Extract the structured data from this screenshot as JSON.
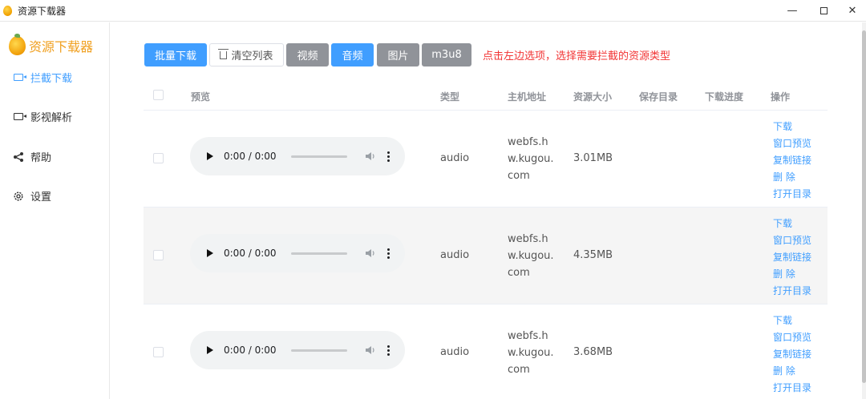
{
  "window": {
    "title": "资源下载器",
    "controls": {
      "minimize": "—",
      "close": "✕"
    }
  },
  "sidebar": {
    "app_name": "资源下载器",
    "items": [
      {
        "label": "拦截下载",
        "icon": "video-camera-icon",
        "active": true
      },
      {
        "label": "影视解析",
        "icon": "video-camera-icon",
        "active": false
      },
      {
        "label": "帮助",
        "icon": "share-icon",
        "active": false
      },
      {
        "label": "设置",
        "icon": "gear-icon",
        "active": false
      }
    ]
  },
  "toolbar": {
    "batch_download": "批量下载",
    "clear_list": "清空列表",
    "filters": {
      "video": "视频",
      "audio": "音频",
      "image": "图片",
      "m3u8": "m3u8"
    },
    "active_filter": "audio",
    "hint": "点击左边选项，选择需要拦截的资源类型"
  },
  "table": {
    "headers": {
      "preview": "预览",
      "type": "类型",
      "host": "主机地址",
      "size": "资源大小",
      "save_dir": "保存目录",
      "progress": "下载进度",
      "actions": "操作"
    },
    "rows": [
      {
        "time": "0:00 / 0:00",
        "type": "audio",
        "host": "webfs.hw.kugou.com",
        "size": "3.01MB",
        "save_dir": "",
        "progress": ""
      },
      {
        "time": "0:00 / 0:00",
        "type": "audio",
        "host": "webfs.hw.kugou.com",
        "size": "4.35MB",
        "save_dir": "",
        "progress": ""
      },
      {
        "time": "0:00 / 0:00",
        "type": "audio",
        "host": "webfs.hw.kugou.com",
        "size": "3.68MB",
        "save_dir": "",
        "progress": ""
      }
    ],
    "row_actions": {
      "download": "下载",
      "preview_window": "窗口预览",
      "copy_link": "复制链接",
      "delete": "删 除",
      "open_dir": "打开目录"
    }
  },
  "colors": {
    "primary": "#409eff",
    "gray_button": "#909399",
    "hint": "#f23535",
    "brand": "#f0a020"
  }
}
